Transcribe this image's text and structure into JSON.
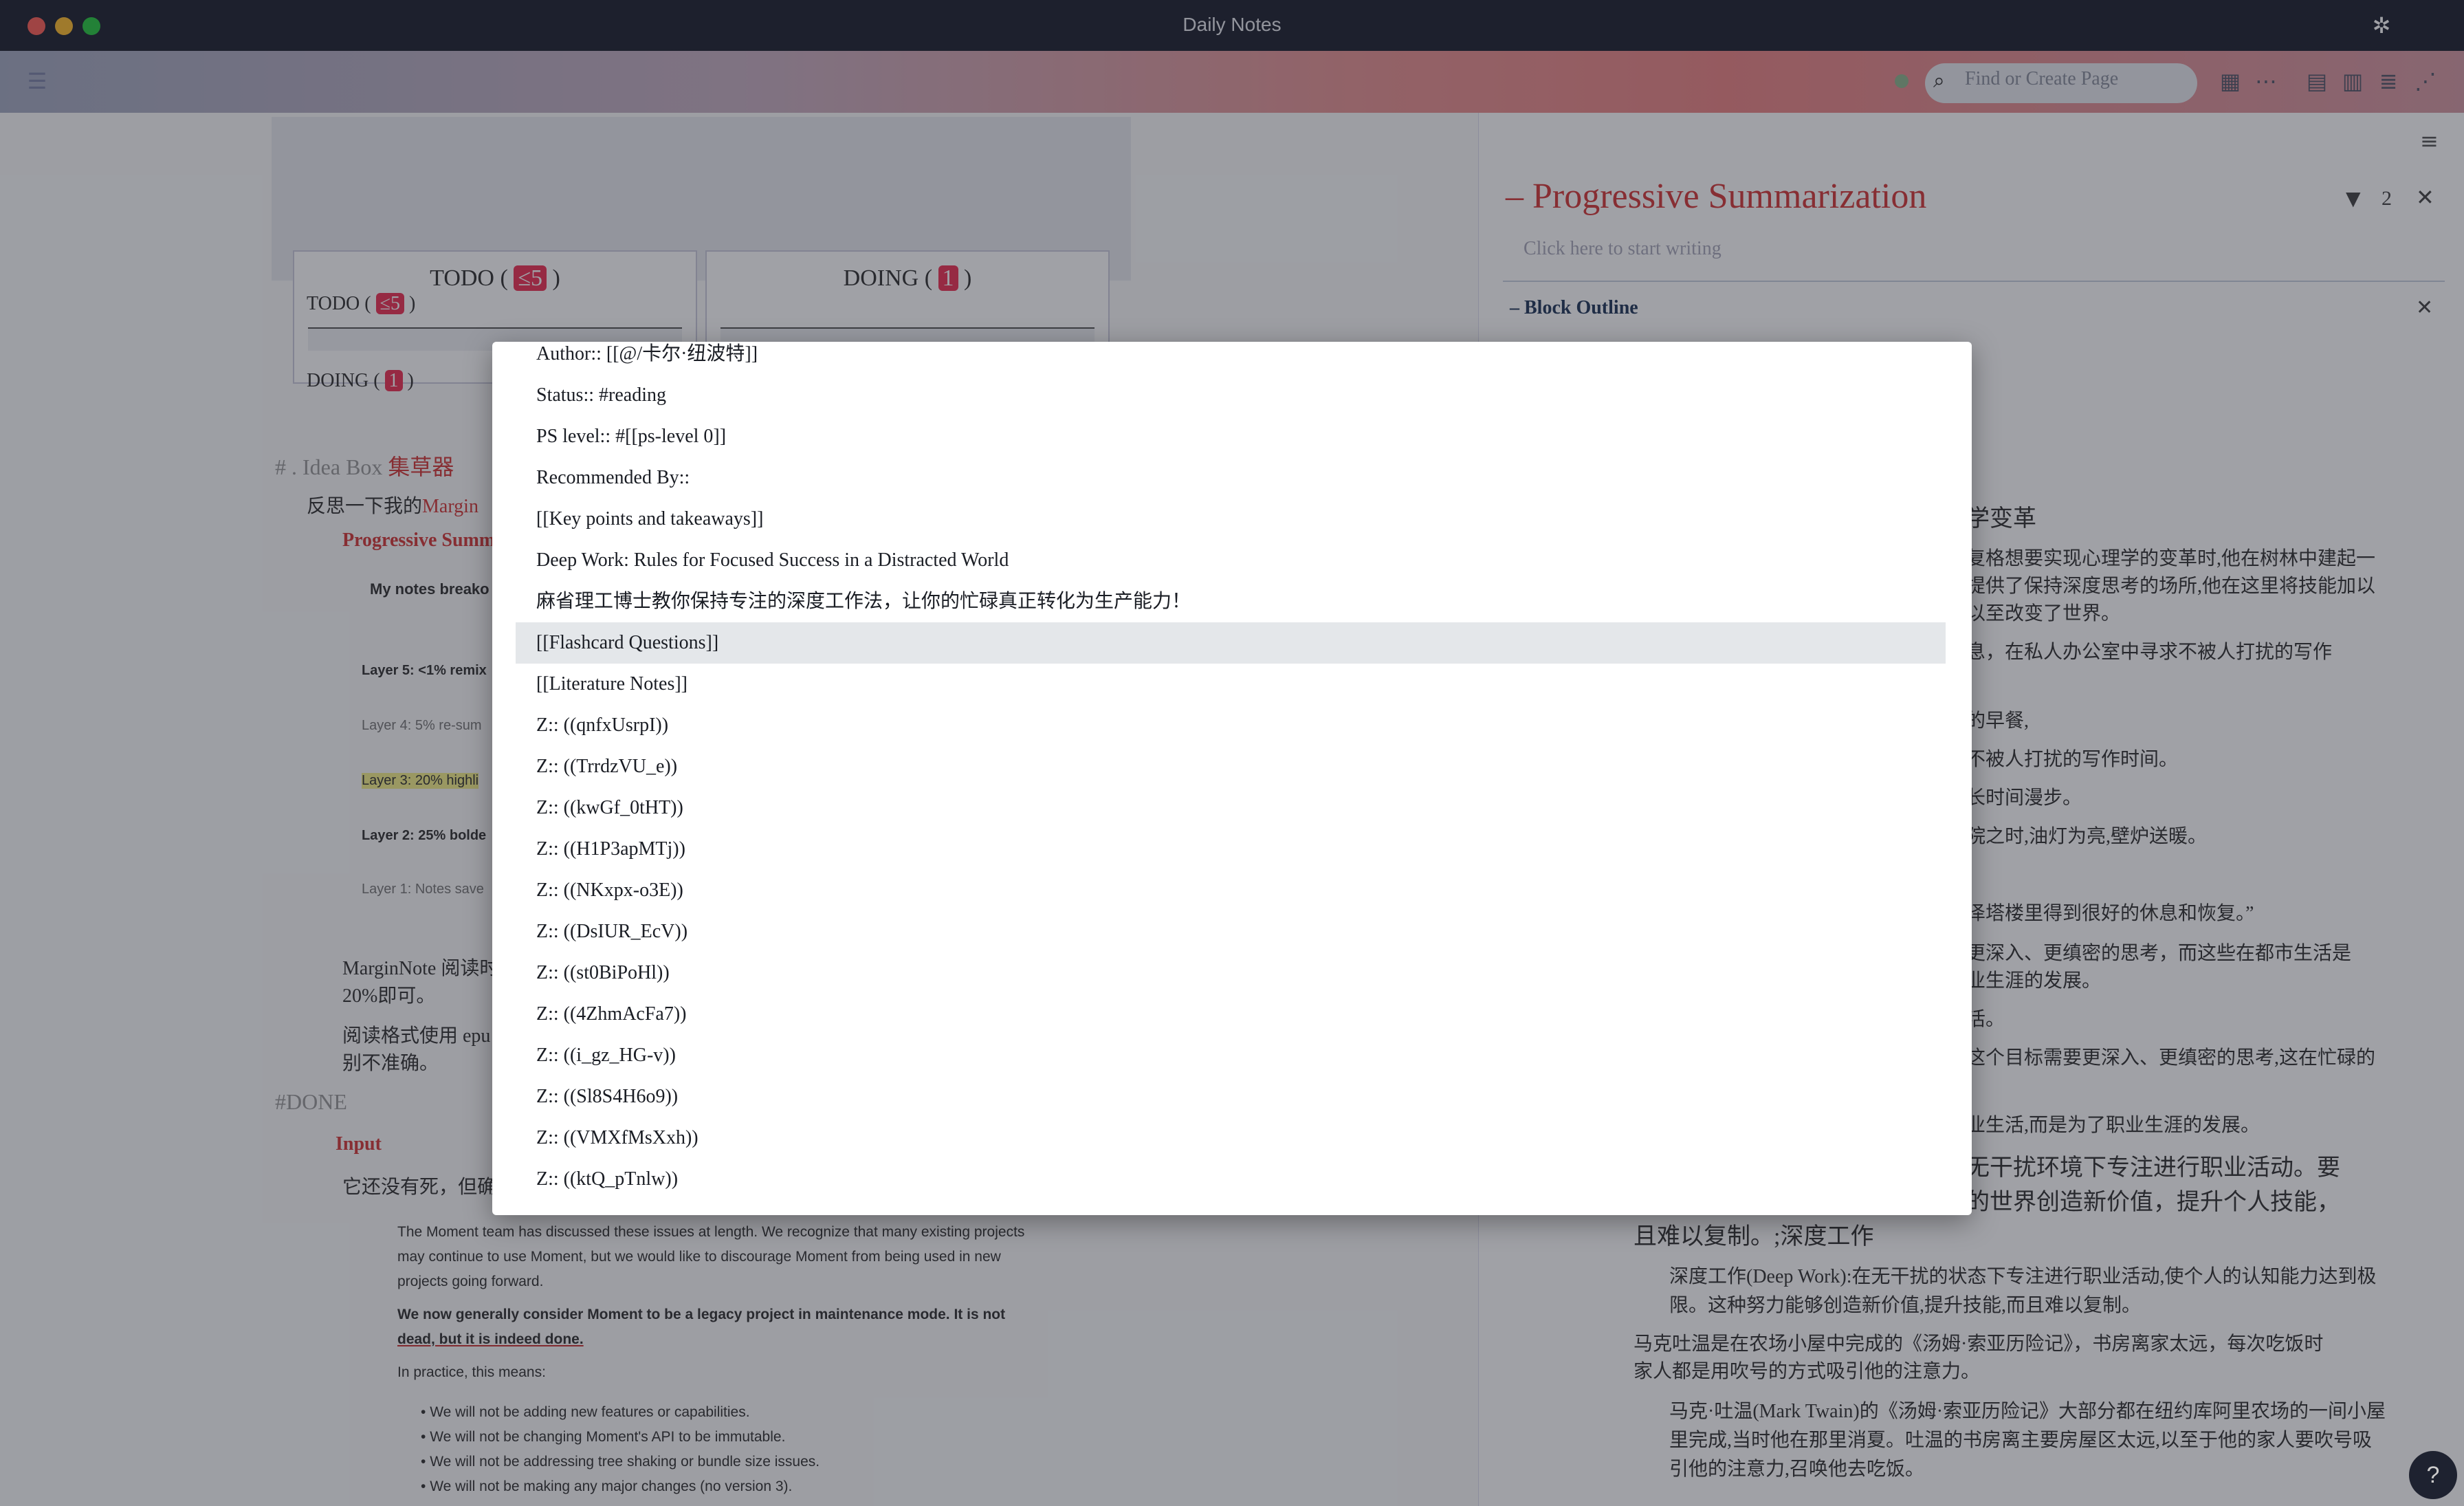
{
  "window": {
    "title": "Daily Notes"
  },
  "colors": {
    "accent": "#d43a3a",
    "titlebar": "#1e2230",
    "selection": "#e4e7ea"
  },
  "toolbar": {
    "search_placeholder": "Find or Create Page",
    "icons": [
      "menu-icon",
      "sync-status-icon",
      "search-icon",
      "calendar-icon",
      "more-icon",
      "table-icon",
      "kanban-icon",
      "outline-icon",
      "graph-icon",
      "sidebar-toggle-icon",
      "extensions-icon"
    ]
  },
  "left_page": {
    "kanban": [
      {
        "label": "TODO ( ",
        "count": "≤5",
        "end": " )"
      },
      {
        "label": "DOING ( ",
        "count": "1",
        "end": " )"
      }
    ],
    "blocks": {
      "todo": "TODO (",
      "todo_count": "≤5",
      "doing": "DOING (",
      "doing_count": "1",
      "idea_box": "# . Idea Box",
      "idea_box_zh": "集草器",
      "reflect": "反思一下我的",
      "reflect_link": "Margin",
      "progressive": "Progressive Summ",
      "notes_break": "My notes breako",
      "layer5": "Layer 5: <1% remix",
      "layer4": "Layer 4: 5% re-sum",
      "layer3": "Layer 3: 20% highli",
      "layer2": "Layer 2: 25% bolde",
      "layer1": "Layer 1: Notes save",
      "marginnote": "MarginNote 阅读时",
      "marginnote2": "20%即可。",
      "epub": "阅读格式使用 epu",
      "epub2": "别不准确。",
      "done": "#DONE",
      "input": "Input",
      "alive": "它还没有死，但确",
      "moment1": "The Moment team has discussed these issues at length. We recognize that many existing projects",
      "moment2": "may continue to use Moment, but we would like to discourage Moment from being used in new",
      "moment3": "projects going forward.",
      "moment4": "We now generally consider Moment to be a legacy project in maintenance mode. It is not",
      "moment5": "dead, but it is indeed done.",
      "moment6": "In practice, this means:",
      "bullet1": "We will not be adding new features or capabilities.",
      "bullet2": "We will not be changing Moment's API to be immutable.",
      "bullet3": "We will not be addressing tree shaking or bundle size issues.",
      "bullet4": "We will not be making any major changes (no version 3)."
    }
  },
  "right_sidebar": {
    "page_title": "Progressive Summarization",
    "filter_count": "2",
    "placeholder": "Click here to start writing",
    "block_outline": "Block Outline",
    "lines": [
      "学变革",
      "复格想要实现心理学的变革时,他在树林中建起一",
      "提供了保持深度思考的场所,他在这里将技能加以",
      "以至改变了世界。",
      "息，在私人办公室中寻求不被人打扰的写作",
      "的早餐,",
      "不被人打扰的写作时间。",
      "长时间漫步。",
      "院之时,油灯为亮,壁炉送暖。",
      "泽塔楼里得到很好的休息和恢复。”",
      "更深入、更缜密的思考，而这些在都市生活是",
      "业生涯的发展。",
      "活。",
      "这个目标需要更深入、更缜密的思考,这在忙碌的",
      "业生活,而是为了职业生涯的发展。",
      "无干扰环境下专注进行职业活动。要",
      "的世界创造新价值，提升个人技能，",
      "且难以复制。;深度工作",
      "深度工作(Deep Work):在无干扰的状态下专注进行职业活动,使个人的认知能力达到极",
      "限。这种努力能够创造新价值,提升技能,而且难以复制。",
      "马克吐温是在农场小屋中完成的《汤姆·索亚历险记》，书房离家太远，每次吃饭时",
      "家人都是用吹号的方式吸引他的注意力。",
      "马克·吐温(Mark Twain)的《汤姆·索亚历险记》大部分都在纽约库阿里农场的一间小屋",
      "里完成,当时他在那里消夏。吐温的书房离主要房屋区太远,以至于他的家人要吹号吸",
      "引他的注意力,召唤他去吃饭。"
    ]
  },
  "modal": {
    "items": [
      "Author:: [[@/卡尔·纽波特]]",
      "Status:: #reading",
      "PS level:: #[[ps-level 0]]",
      "Recommended By::",
      "[[Key points and takeaways]]",
      "Deep Work: Rules for Focused Success in a Distracted World",
      "麻省理工博士教你保持专注的深度工作法，让你的忙碌真正转化为生产能力！",
      "[[Flashcard Questions]]",
      "[[Literature Notes]]",
      "Z:: ((qnfxUsrpI))",
      "Z:: ((TrrdzVU_e))",
      "Z:: ((kwGf_0tHT))",
      "Z:: ((H1P3apMTj))",
      "Z:: ((NKxpx-o3E))",
      "Z:: ((DsIUR_EcV))",
      "Z:: ((st0BiPoHl))",
      "Z:: ((4ZhmAcFa7))",
      "Z:: ((i_gz_HG-v))",
      "Z:: ((Sl8S4H6o9))",
      "Z:: ((VMXfMsXxh))",
      "Z:: ((ktQ_pTnlw))"
    ],
    "active_index": 7
  },
  "help": {
    "label": "?"
  }
}
